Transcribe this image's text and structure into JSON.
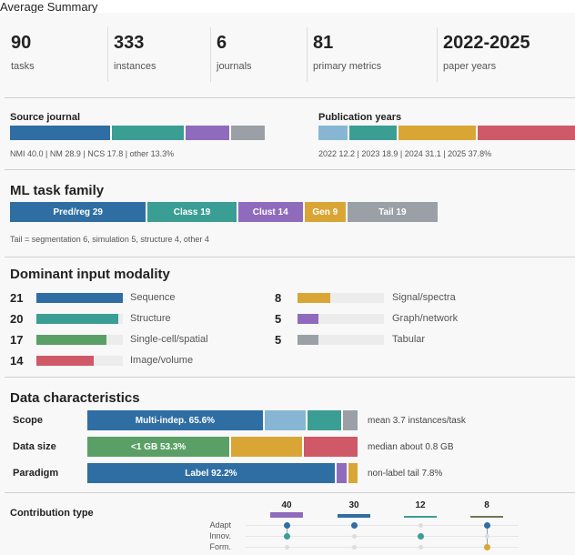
{
  "header_text": "Average Summary",
  "stats": [
    {
      "value": "90",
      "label": "tasks"
    },
    {
      "value": "333",
      "label": "instances"
    },
    {
      "value": "6",
      "label": "journals"
    },
    {
      "value": "81",
      "label": "primary metrics"
    },
    {
      "value": "2022-2025",
      "label": "paper years"
    }
  ],
  "source_journal": {
    "title": "Source journal",
    "segments": [
      {
        "name": "NMI",
        "value": 40.0,
        "color": "#2f6ea3"
      },
      {
        "name": "NM",
        "value": 28.9,
        "color": "#3a9e94"
      },
      {
        "name": "NCS",
        "value": 17.8,
        "color": "#8f6bbd"
      },
      {
        "name": "other",
        "value": 13.3,
        "color": "#9aa0a6"
      }
    ],
    "note": "NMI 40.0 | NM 28.9 | NCS 17.8 | other 13.3%"
  },
  "publication_years": {
    "title": "Publication years",
    "segments": [
      {
        "name": "2022",
        "value": 12.2,
        "color": "#86b6d4"
      },
      {
        "name": "2023",
        "value": 18.9,
        "color": "#3a9e94"
      },
      {
        "name": "2024",
        "value": 31.1,
        "color": "#d9a636"
      },
      {
        "name": "2025",
        "value": 37.8,
        "color": "#cf5966"
      }
    ],
    "note": "2022 12.2 | 2023 18.9 | 2024 31.1 | 2025 37.8%"
  },
  "ml_task_family": {
    "title": "ML task family",
    "segments": [
      {
        "label": "Pred/reg 29",
        "value": 29,
        "color": "#2f6ea3"
      },
      {
        "label": "Class 19",
        "value": 19,
        "color": "#3a9e94"
      },
      {
        "label": "Clust 14",
        "value": 14,
        "color": "#8f6bbd"
      },
      {
        "label": "Gen 9",
        "value": 9,
        "color": "#d9a636"
      },
      {
        "label": "Tail 19",
        "value": 19,
        "color": "#9aa0a6"
      }
    ],
    "note": "Tail = segmentation 6, simulation 5, structure 4, other 4"
  },
  "modality": {
    "title": "Dominant input modality",
    "max": 21,
    "items": [
      {
        "count": "21",
        "value": 21,
        "label": "Sequence",
        "color": "#2f6ea3"
      },
      {
        "count": "20",
        "value": 20,
        "label": "Structure",
        "color": "#3a9e94"
      },
      {
        "count": "17",
        "value": 17,
        "label": "Single-cell/spatial",
        "color": "#5aa066"
      },
      {
        "count": "14",
        "value": 14,
        "label": "Image/volume",
        "color": "#cf5966"
      },
      {
        "count": "8",
        "value": 8,
        "label": "Signal/spectra",
        "color": "#d9a636"
      },
      {
        "count": "5",
        "value": 5,
        "label": "Graph/network",
        "color": "#8f6bbd"
      },
      {
        "count": "5",
        "value": 5,
        "label": "Tabular",
        "color": "#9aa0a6"
      }
    ]
  },
  "data_characteristics": {
    "title": "Data characteristics",
    "rows": [
      {
        "label": "Scope",
        "note": "mean 3.7 instances/task",
        "segments": [
          {
            "label": "Multi-indep. 65.6%",
            "value": 65.6,
            "color": "#2f6ea3"
          },
          {
            "label": "",
            "value": 16.0,
            "color": "#86b6d4"
          },
          {
            "label": "",
            "value": 13.0,
            "color": "#3a9e94"
          },
          {
            "label": "",
            "value": 5.4,
            "color": "#9aa0a6"
          }
        ]
      },
      {
        "label": "Data size",
        "note": "median about 0.8 GB",
        "segments": [
          {
            "label": "<1 GB 53.3%",
            "value": 53.3,
            "color": "#5aa066"
          },
          {
            "label": "",
            "value": 26.7,
            "color": "#d9a636"
          },
          {
            "label": "",
            "value": 20.0,
            "color": "#cf5966"
          }
        ]
      },
      {
        "label": "Paradigm",
        "note": "non-label tail 7.8%",
        "segments": [
          {
            "label": "Label 92.2%",
            "value": 92.2,
            "color": "#2f6ea3"
          },
          {
            "label": "",
            "value": 4.3,
            "color": "#8f6bbd"
          },
          {
            "label": "",
            "value": 3.5,
            "color": "#d9a636"
          }
        ]
      }
    ]
  },
  "contribution": {
    "title": "Contribution type",
    "row_labels": [
      "Adapt",
      "Innov.",
      "Form."
    ],
    "columns": [
      {
        "count": "40",
        "color": "#8f6bbd",
        "dots": [
          {
            "on": true,
            "color": "#2f6ea3"
          },
          {
            "on": true,
            "color": "#3a9e94"
          },
          {
            "on": false,
            "color": "#cccccc"
          }
        ]
      },
      {
        "count": "30",
        "color": "#2f6ea3",
        "dots": [
          {
            "on": true,
            "color": "#2f6ea3"
          },
          {
            "on": false,
            "color": "#cccccc"
          },
          {
            "on": false,
            "color": "#cccccc"
          }
        ]
      },
      {
        "count": "12",
        "color": "#3a9e94",
        "dots": [
          {
            "on": false,
            "color": "#cccccc"
          },
          {
            "on": true,
            "color": "#3a9e94"
          },
          {
            "on": false,
            "color": "#cccccc"
          }
        ]
      },
      {
        "count": "8",
        "color": "#6b7a55",
        "dots": [
          {
            "on": true,
            "color": "#2f6ea3"
          },
          {
            "on": false,
            "color": "#cccccc"
          },
          {
            "on": true,
            "color": "#d9a636"
          }
        ]
      }
    ]
  }
}
